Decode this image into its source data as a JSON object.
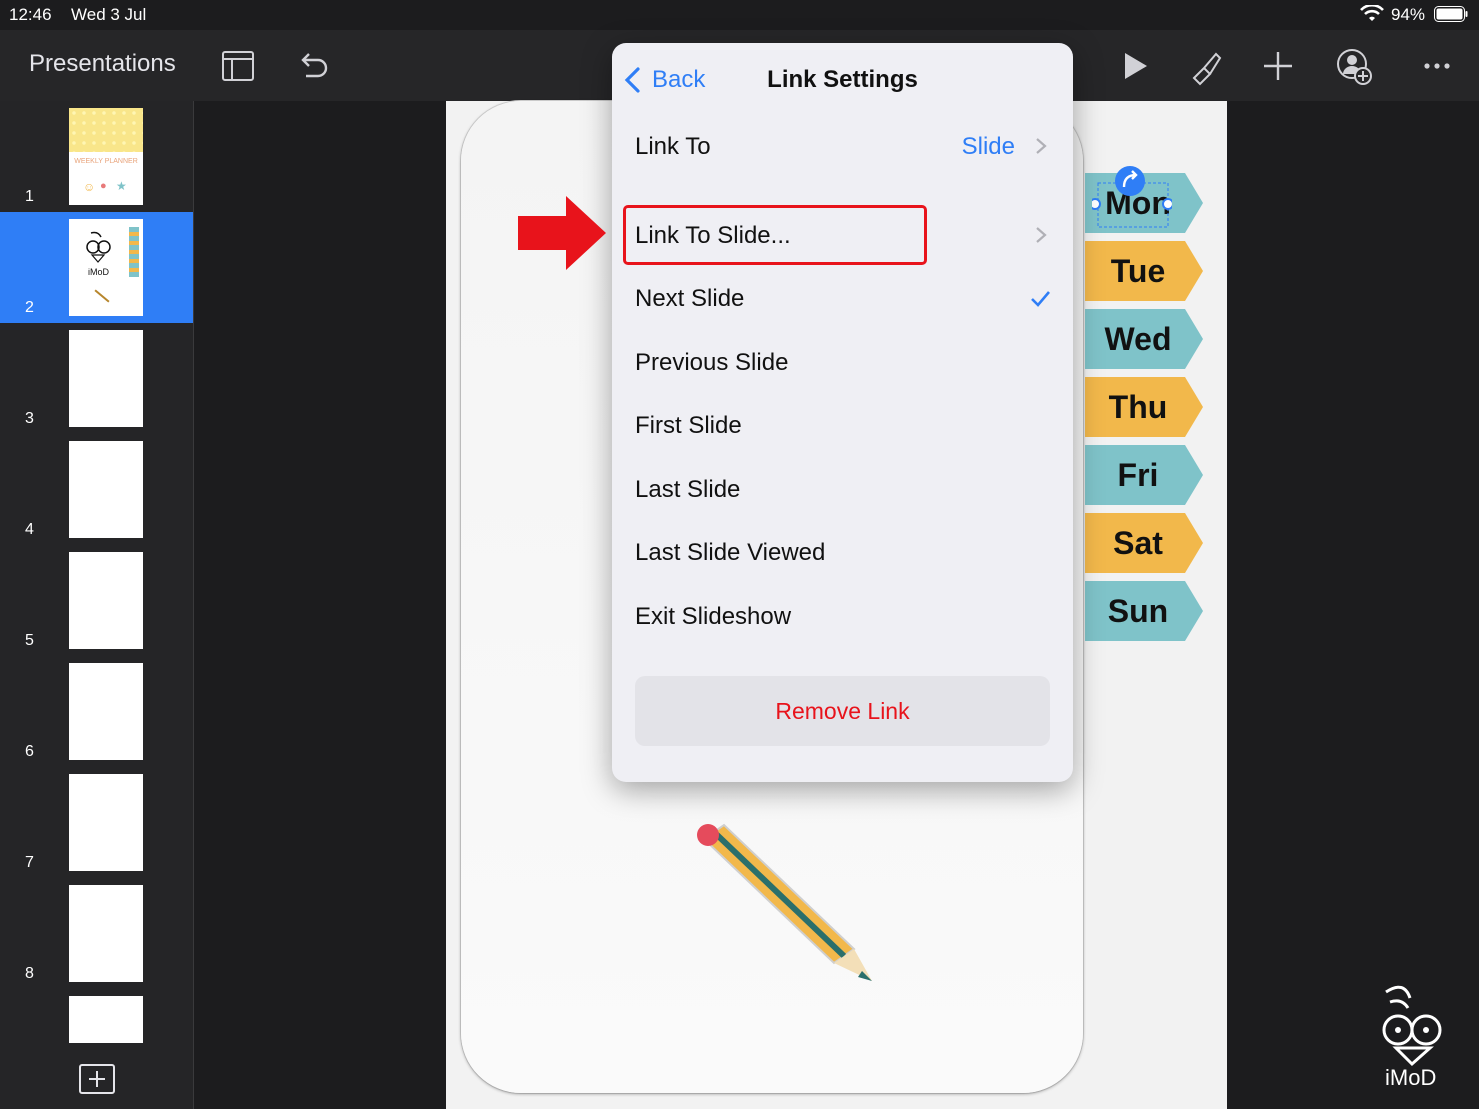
{
  "status_bar": {
    "time": "12:46",
    "date": "Wed 3 Jul",
    "battery": "94%"
  },
  "toolbar": {
    "presentations_label": "Presentations"
  },
  "sidebar": {
    "slides": [
      {
        "number": "1",
        "title": "WEEKLY PLANNER"
      },
      {
        "number": "2",
        "logo": "iMoD"
      },
      {
        "number": "3"
      },
      {
        "number": "4"
      },
      {
        "number": "5"
      },
      {
        "number": "6"
      },
      {
        "number": "7"
      },
      {
        "number": "8"
      }
    ],
    "selected_index": 2
  },
  "slide": {
    "days": [
      "Mon",
      "Tue",
      "Wed",
      "Thu",
      "Fri",
      "Sat",
      "Sun"
    ],
    "colors": {
      "teal": "#7fc3c9",
      "yellow": "#f2b84b"
    }
  },
  "popover": {
    "back_label": "Back",
    "title": "Link Settings",
    "link_to_label": "Link To",
    "link_to_value": "Slide",
    "options": [
      "Link To Slide...",
      "Next Slide",
      "Previous Slide",
      "First Slide",
      "Last Slide",
      "Last Slide Viewed",
      "Exit Slideshow"
    ],
    "selected_option": "Next Slide",
    "remove_label": "Remove Link"
  },
  "watermark": {
    "text": "iMoD"
  },
  "accent": "#2f7ef6",
  "alert": "#e8131b"
}
